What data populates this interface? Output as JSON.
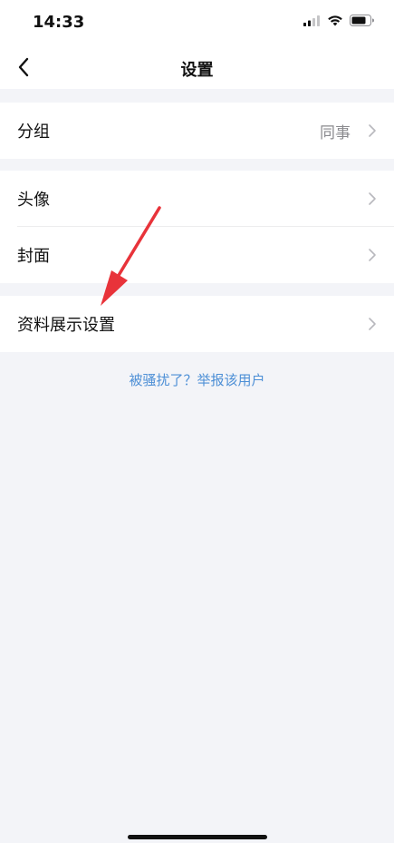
{
  "status_bar": {
    "time": "14:33",
    "icons": [
      "signal-icon",
      "wifi-icon",
      "battery-icon"
    ]
  },
  "nav": {
    "title": "设置",
    "back_icon": "chevron-left-icon"
  },
  "groups": {
    "group1": {
      "items": [
        {
          "label": "分组",
          "value": "同事"
        }
      ]
    },
    "group2": {
      "items": [
        {
          "label": "头像"
        },
        {
          "label": "封面"
        }
      ]
    },
    "group3": {
      "items": [
        {
          "label": "资料展示设置"
        }
      ]
    }
  },
  "report_link": "被骚扰了？举报该用户",
  "annotation": {
    "icon": "red-arrow-icon",
    "color": "#e8333a"
  },
  "colors": {
    "background": "#f3f4f8",
    "card": "#ffffff",
    "link": "#4d8fd6",
    "secondary_text": "#8a8a8e",
    "chevron": "#b8b8bd"
  }
}
